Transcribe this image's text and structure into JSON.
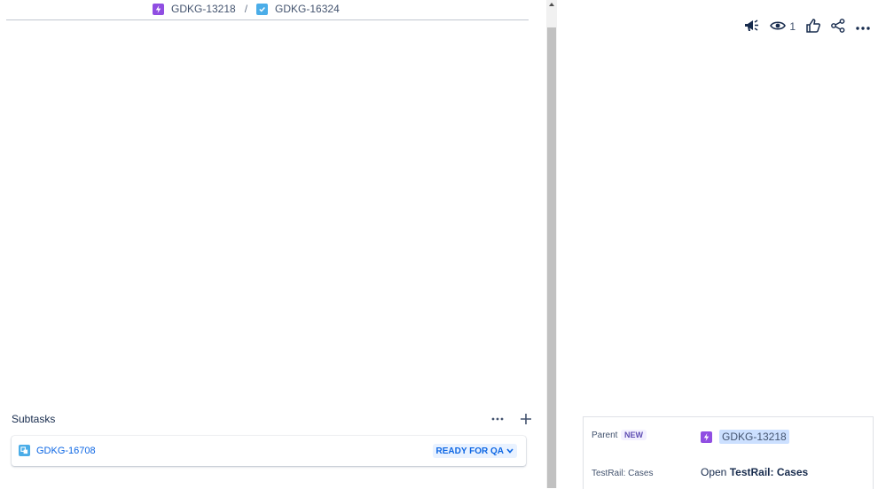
{
  "breadcrumb": {
    "parent_key": "GDKG-13218",
    "separator": "/",
    "current_key": "GDKG-16324"
  },
  "subtasks": {
    "title": "Subtasks",
    "items": [
      {
        "key": "GDKG-16708",
        "status": "READY FOR QA"
      }
    ]
  },
  "toolbar": {
    "watch_count": "1"
  },
  "details": {
    "parent_label": "Parent",
    "parent_badge": "NEW",
    "parent_value": "GDKG-13218",
    "testrail_label": "TestRail: Cases",
    "testrail_prefix": "Open",
    "testrail_link": "TestRail: Cases"
  },
  "colors": {
    "epic": "#904ee2",
    "task": "#4bade8",
    "link": "#0c66e4",
    "status_bg": "#e9f2ff"
  }
}
